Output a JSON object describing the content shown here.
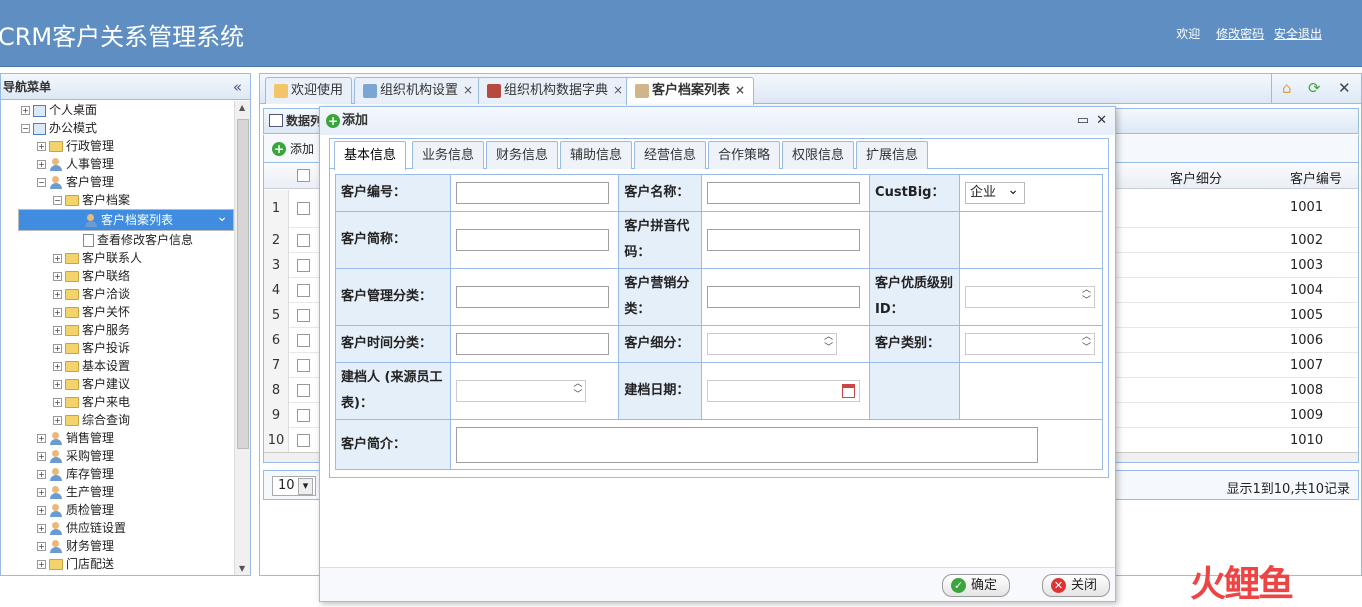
{
  "header": {
    "app_title": "CRM客户关系管理系统",
    "welcome": "欢迎",
    "change_password": "修改密码",
    "logout": "安全退出"
  },
  "nav": {
    "title": "导航菜单",
    "collapse_icon": "«",
    "items": [
      {
        "label": "个人桌面"
      },
      {
        "label": "办公模式"
      },
      {
        "label": "行政管理"
      },
      {
        "label": "人事管理"
      },
      {
        "label": "客户管理"
      },
      {
        "label": "客户档案"
      },
      {
        "label": "客户档案列表"
      },
      {
        "label": "查看修改客户信息"
      },
      {
        "label": "客户联系人"
      },
      {
        "label": "客户联络"
      },
      {
        "label": "客户洽谈"
      },
      {
        "label": "客户关怀"
      },
      {
        "label": "客户服务"
      },
      {
        "label": "客户投诉"
      },
      {
        "label": "基本设置"
      },
      {
        "label": "客户建议"
      },
      {
        "label": "客户来电"
      },
      {
        "label": "综合查询"
      },
      {
        "label": "销售管理"
      },
      {
        "label": "采购管理"
      },
      {
        "label": "库存管理"
      },
      {
        "label": "生产管理"
      },
      {
        "label": "质检管理"
      },
      {
        "label": "供应链设置"
      },
      {
        "label": "财务管理"
      },
      {
        "label": "门店配送"
      }
    ]
  },
  "tabs": [
    {
      "label": "欢迎使用"
    },
    {
      "label": "组织机构设置"
    },
    {
      "label": "组织机构数据字典"
    },
    {
      "label": "客户档案列表"
    }
  ],
  "grid": {
    "title": "数据列",
    "add_label": "添加",
    "col_cust_detail": "客户细分",
    "col_cust_no": "客户编号",
    "rows": [
      {
        "n": "1",
        "no": "1001"
      },
      {
        "n": "2",
        "no": "1002"
      },
      {
        "n": "3",
        "no": "1003"
      },
      {
        "n": "4",
        "no": "1004"
      },
      {
        "n": "5",
        "no": "1005"
      },
      {
        "n": "6",
        "no": "1006"
      },
      {
        "n": "7",
        "no": "1007"
      },
      {
        "n": "8",
        "no": "1008"
      },
      {
        "n": "9",
        "no": "1009"
      },
      {
        "n": "10",
        "no": "1010"
      }
    ],
    "page_size": "10",
    "page_info": "显示1到10,共10记录"
  },
  "dialog": {
    "title": "添加",
    "tabs": [
      "基本信息",
      "业务信息",
      "财务信息",
      "辅助信息",
      "经营信息",
      "合作策略",
      "权限信息",
      "扩展信息"
    ],
    "labels": {
      "cust_no": "客户编号：",
      "cust_name": "客户名称：",
      "custbig": "CustBig：",
      "cust_short": "客户简称：",
      "cust_pinyin": "客户拼音代码：",
      "cust_mgmt_class": "客户管理分类：",
      "cust_mkt_class": "客户营销分类：",
      "cust_quality_id": "客户优质级别ID：",
      "cust_time_class": "客户时间分类：",
      "cust_detail": "客户细分：",
      "cust_type": "客户类别：",
      "creator": "建档人 (来源员工表)：",
      "create_date": "建档日期：",
      "cust_intro": "客户简介："
    },
    "custbig_value": "企业",
    "ok_label": "确定",
    "close_label": "关闭"
  },
  "watermark": "火鲤鱼",
  "colors": {
    "header_bg": "#5f8fc2",
    "label_bg": "#e5effa",
    "border": "#99bbe8",
    "selected": "#3f8ce0"
  }
}
